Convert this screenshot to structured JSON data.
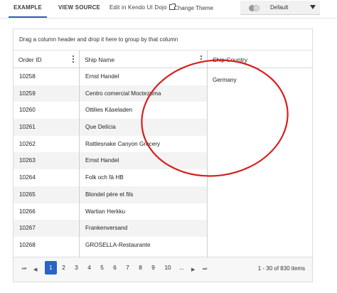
{
  "topbar": {
    "tabs": [
      "EXAMPLE",
      "VIEW SOURCE",
      "Edit in Kendo UI Dojo"
    ],
    "theme_label": "Change Theme",
    "theme_value": "Default"
  },
  "grid": {
    "group_hint": "Drag a column header and drop it here to group by that column",
    "columns": [
      "Order ID",
      "Ship Name",
      "Ship Country"
    ],
    "rows": [
      {
        "order_id": "10258",
        "ship_name": "Ernst Handel"
      },
      {
        "order_id": "10259",
        "ship_name": "Centro comercial Moctezuma"
      },
      {
        "order_id": "10260",
        "ship_name": "Ottilies Käseladen"
      },
      {
        "order_id": "10261",
        "ship_name": "Que Delícia"
      },
      {
        "order_id": "10262",
        "ship_name": "Rattlesnake Canyon Grocery"
      },
      {
        "order_id": "10263",
        "ship_name": "Ernst Handel"
      },
      {
        "order_id": "10264",
        "ship_name": "Folk och fä HB"
      },
      {
        "order_id": "10265",
        "ship_name": "Blondel père et fils"
      },
      {
        "order_id": "10266",
        "ship_name": "Wartian Herkku"
      },
      {
        "order_id": "10267",
        "ship_name": "Frankenversand"
      },
      {
        "order_id": "10268",
        "ship_name": "GROSELLA-Restaurante"
      }
    ],
    "country_value": "Germany"
  },
  "pager": {
    "first": "⏮",
    "prev": "◀",
    "pages": [
      "1",
      "2",
      "3",
      "4",
      "5",
      "6",
      "7",
      "8",
      "9",
      "10",
      "..."
    ],
    "next": "▶",
    "last": "⏭",
    "active_page": "1",
    "info": "1 - 30 of 830 items"
  },
  "colors": {
    "accent": "#2a62c7",
    "annotation": "#d61f1f"
  }
}
